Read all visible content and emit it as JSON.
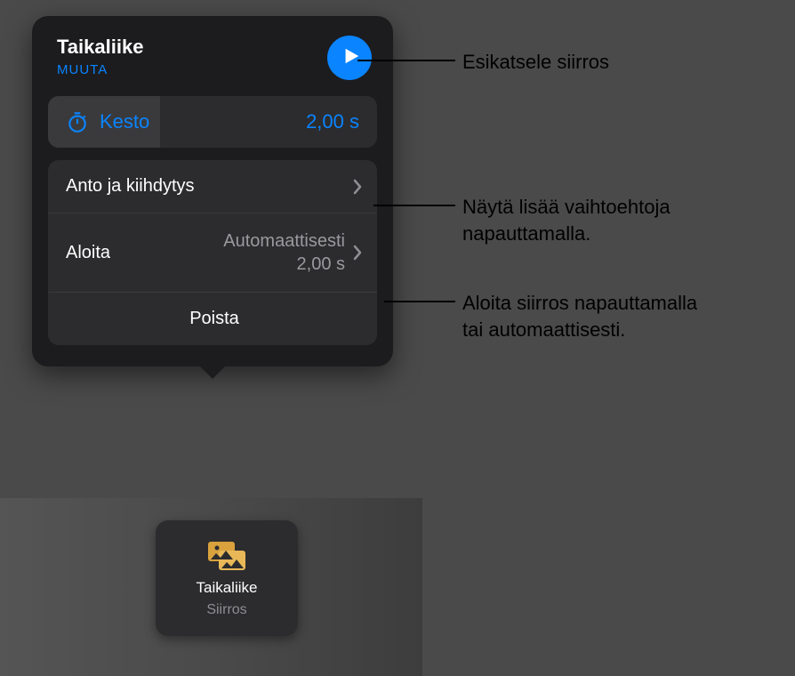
{
  "popover": {
    "title": "Taikaliike",
    "change_link": "MUUTA",
    "duration": {
      "label": "Kesto",
      "value": "2,00 s"
    },
    "rows": {
      "easing": {
        "label": "Anto ja kiihdytys"
      },
      "start": {
        "label": "Aloita",
        "value_line1": "Automaattisesti",
        "value_line2": "2,00 s"
      }
    },
    "delete_label": "Poista"
  },
  "chip": {
    "title": "Taikaliike",
    "subtitle": "Siirros"
  },
  "callouts": {
    "preview": "Esikatsele siirros",
    "more_options_l1": "Näytä lisää vaihtoehtoja",
    "more_options_l2": "napauttamalla.",
    "start_l1": "Aloita siirros napauttamalla",
    "start_l2": "tai automaattisesti."
  },
  "colors": {
    "accent": "#0a84ff"
  }
}
